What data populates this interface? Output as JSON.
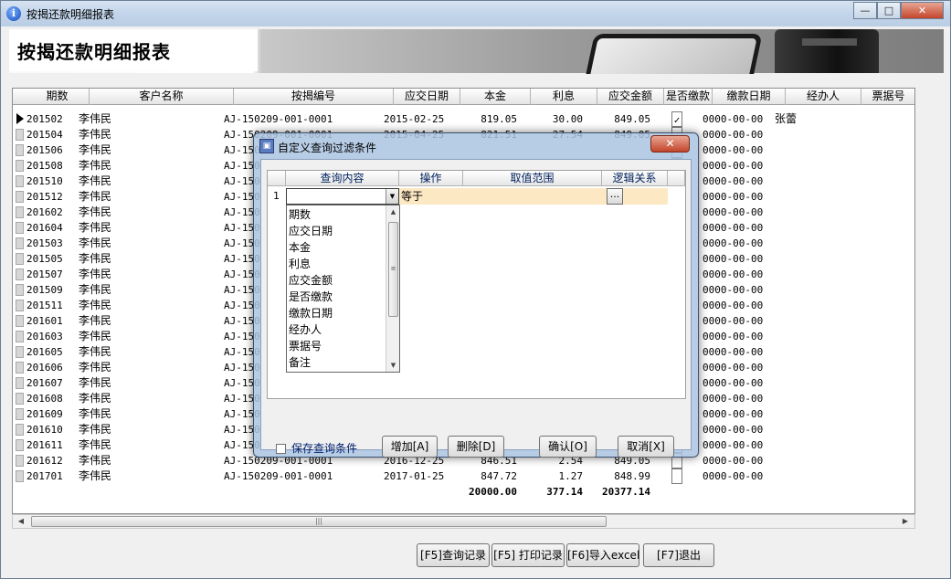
{
  "window": {
    "title": "按揭还款明细报表",
    "icon": "info-icon"
  },
  "banner": {
    "heading": "按揭还款明细报表"
  },
  "grid": {
    "columns": [
      "期数",
      "客户名称",
      "按揭编号",
      "应交日期",
      "本金",
      "利息",
      "应交金额",
      "是否缴款",
      "缴款日期",
      "经办人",
      "票据号"
    ],
    "rows": [
      {
        "period": "201502",
        "customer": "李伟民",
        "code": "AJ-150209-001-0001",
        "due_date": "2015-02-25",
        "principal": "819.05",
        "interest": "30.00",
        "amount": "849.05",
        "paid": true,
        "pay_date": "0000-00-00",
        "agent": "张蕾",
        "current": true
      },
      {
        "period": "201504",
        "customer": "李伟民",
        "code": "AJ-150209-001-0001",
        "due_date": "2015-04-25",
        "principal": "821.51",
        "interest": "27.54",
        "amount": "849.05",
        "paid": false,
        "pay_date": "0000-00-00",
        "agent": ""
      },
      {
        "period": "201506",
        "customer": "李伟民",
        "code": "AJ-150",
        "due_date": "",
        "principal": "",
        "interest": "",
        "amount": "",
        "paid": false,
        "pay_date": "0000-00-00",
        "agent": ""
      },
      {
        "period": "201508",
        "customer": "李伟民",
        "code": "AJ-150",
        "due_date": "",
        "principal": "",
        "interest": "",
        "amount": "",
        "paid": false,
        "pay_date": "0000-00-00",
        "agent": ""
      },
      {
        "period": "201510",
        "customer": "李伟民",
        "code": "AJ-150",
        "due_date": "",
        "principal": "",
        "interest": "",
        "amount": "",
        "paid": false,
        "pay_date": "0000-00-00",
        "agent": ""
      },
      {
        "period": "201512",
        "customer": "李伟民",
        "code": "AJ-150",
        "due_date": "",
        "principal": "",
        "interest": "",
        "amount": "",
        "paid": false,
        "pay_date": "0000-00-00",
        "agent": ""
      },
      {
        "period": "201602",
        "customer": "李伟民",
        "code": "AJ-150",
        "due_date": "",
        "principal": "",
        "interest": "",
        "amount": "",
        "paid": false,
        "pay_date": "0000-00-00",
        "agent": ""
      },
      {
        "period": "201604",
        "customer": "李伟民",
        "code": "AJ-150",
        "due_date": "",
        "principal": "",
        "interest": "",
        "amount": "",
        "paid": false,
        "pay_date": "0000-00-00",
        "agent": ""
      },
      {
        "period": "201503",
        "customer": "李伟民",
        "code": "AJ-150",
        "due_date": "",
        "principal": "",
        "interest": "",
        "amount": "",
        "paid": false,
        "pay_date": "0000-00-00",
        "agent": ""
      },
      {
        "period": "201505",
        "customer": "李伟民",
        "code": "AJ-150",
        "due_date": "",
        "principal": "",
        "interest": "",
        "amount": "",
        "paid": false,
        "pay_date": "0000-00-00",
        "agent": ""
      },
      {
        "period": "201507",
        "customer": "李伟民",
        "code": "AJ-150",
        "due_date": "",
        "principal": "",
        "interest": "",
        "amount": "",
        "paid": false,
        "pay_date": "0000-00-00",
        "agent": ""
      },
      {
        "period": "201509",
        "customer": "李伟民",
        "code": "AJ-150",
        "due_date": "",
        "principal": "",
        "interest": "",
        "amount": "",
        "paid": false,
        "pay_date": "0000-00-00",
        "agent": ""
      },
      {
        "period": "201511",
        "customer": "李伟民",
        "code": "AJ-150",
        "due_date": "",
        "principal": "",
        "interest": "",
        "amount": "",
        "paid": false,
        "pay_date": "0000-00-00",
        "agent": ""
      },
      {
        "period": "201601",
        "customer": "李伟民",
        "code": "AJ-150",
        "due_date": "",
        "principal": "",
        "interest": "",
        "amount": "",
        "paid": false,
        "pay_date": "0000-00-00",
        "agent": ""
      },
      {
        "period": "201603",
        "customer": "李伟民",
        "code": "AJ-150",
        "due_date": "",
        "principal": "",
        "interest": "",
        "amount": "",
        "paid": false,
        "pay_date": "0000-00-00",
        "agent": ""
      },
      {
        "period": "201605",
        "customer": "李伟民",
        "code": "AJ-150",
        "due_date": "",
        "principal": "",
        "interest": "",
        "amount": "",
        "paid": false,
        "pay_date": "0000-00-00",
        "agent": ""
      },
      {
        "period": "201606",
        "customer": "李伟民",
        "code": "AJ-150",
        "due_date": "",
        "principal": "",
        "interest": "",
        "amount": "",
        "paid": false,
        "pay_date": "0000-00-00",
        "agent": ""
      },
      {
        "period": "201607",
        "customer": "李伟民",
        "code": "AJ-150",
        "due_date": "",
        "principal": "",
        "interest": "",
        "amount": "",
        "paid": false,
        "pay_date": "0000-00-00",
        "agent": ""
      },
      {
        "period": "201608",
        "customer": "李伟民",
        "code": "AJ-150",
        "due_date": "",
        "principal": "",
        "interest": "",
        "amount": "",
        "paid": false,
        "pay_date": "0000-00-00",
        "agent": ""
      },
      {
        "period": "201609",
        "customer": "李伟民",
        "code": "AJ-150",
        "due_date": "",
        "principal": "",
        "interest": "",
        "amount": "",
        "paid": false,
        "pay_date": "0000-00-00",
        "agent": ""
      },
      {
        "period": "201610",
        "customer": "李伟民",
        "code": "AJ-150",
        "due_date": "",
        "principal": "",
        "interest": "",
        "amount": "",
        "paid": false,
        "pay_date": "0000-00-00",
        "agent": ""
      },
      {
        "period": "201611",
        "customer": "李伟民",
        "code": "AJ-150",
        "due_date": "",
        "principal": "",
        "interest": "",
        "amount": "",
        "paid": false,
        "pay_date": "0000-00-00",
        "agent": ""
      },
      {
        "period": "201612",
        "customer": "李伟民",
        "code": "AJ-150209-001-0001",
        "due_date": "2016-12-25",
        "principal": "846.51",
        "interest": "2.54",
        "amount": "849.05",
        "paid": false,
        "pay_date": "0000-00-00",
        "agent": ""
      },
      {
        "period": "201701",
        "customer": "李伟民",
        "code": "AJ-150209-001-0001",
        "due_date": "2017-01-25",
        "principal": "847.72",
        "interest": "1.27",
        "amount": "848.99",
        "paid": false,
        "pay_date": "0000-00-00",
        "agent": ""
      }
    ],
    "totals": {
      "principal": "20000.00",
      "interest": "377.14",
      "amount": "20377.14"
    }
  },
  "buttons": {
    "query": "[F5]查询记录",
    "print": "[F5] 打印记录",
    "export": "[F6]导入excel",
    "exit": "[F7]退出"
  },
  "dialog": {
    "title": "自定义查询过滤条件",
    "close_label": "✕",
    "columns": [
      "查询内容",
      "操作",
      "取值范围",
      "逻辑关系"
    ],
    "row_number": "1",
    "operator": "等于",
    "ellipsis": "...",
    "options": [
      "期数",
      "应交日期",
      "本金",
      "利息",
      "应交金额",
      "是否缴款",
      "缴款日期",
      "经办人",
      "票据号",
      "备注"
    ],
    "save_label": "保存查询条件",
    "add_label": "增加[A]",
    "delete_label": "删除[D]",
    "ok_label": "确认[O]",
    "cancel_label": "取消[X]"
  }
}
